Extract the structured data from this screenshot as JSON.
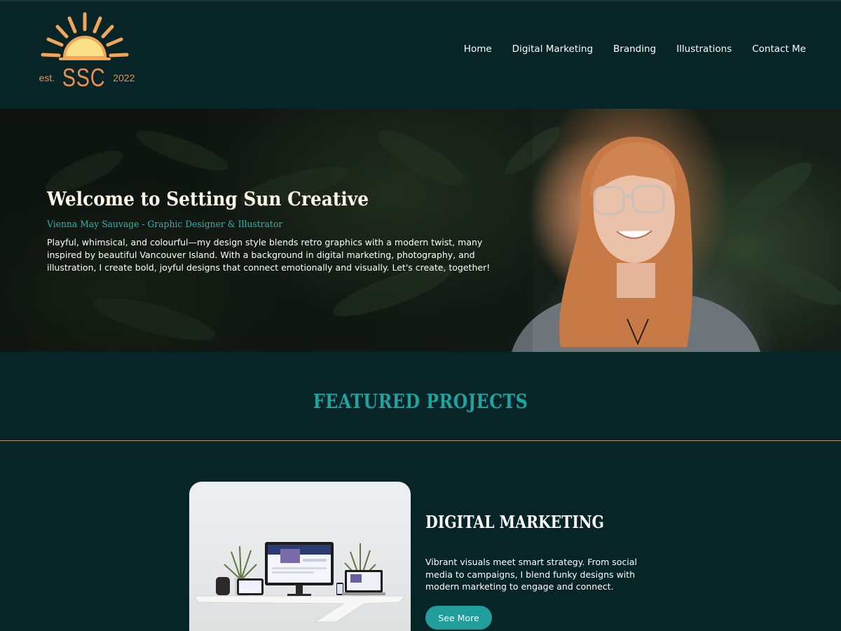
{
  "logo": {
    "est": "est.",
    "initials": "SSC",
    "year": "2022"
  },
  "nav": {
    "items": [
      {
        "label": "Home"
      },
      {
        "label": "Digital Marketing"
      },
      {
        "label": "Branding"
      },
      {
        "label": "Illustrations"
      },
      {
        "label": "Contact Me"
      }
    ]
  },
  "hero": {
    "title": "Welcome to Setting Sun Creative",
    "subtitle": "Vienna May Sauvage - Graphic Designer & Illustrator",
    "body": "Playful, whimsical, and colourful—my design style blends retro graphics with a modern twist, many inspired by beautiful Vancouver Island. With a background in digital marketing, photography, and illustration, I create bold, joyful designs that connect emotionally and visually. Let's create, together!"
  },
  "featured": {
    "title": "FEATURED PROJECTS",
    "projects": [
      {
        "heading": "DIGITAL MARKETING",
        "body": "Vibrant visuals meet smart strategy. From social media to campaigns, I blend funky designs with modern marketing to engage and connect.",
        "button": "See More"
      }
    ]
  },
  "colors": {
    "background": "#072427",
    "accent_teal": "#1fa3a0",
    "accent_orange": "#e98f56",
    "sun_yellow": "#fbe08a"
  }
}
